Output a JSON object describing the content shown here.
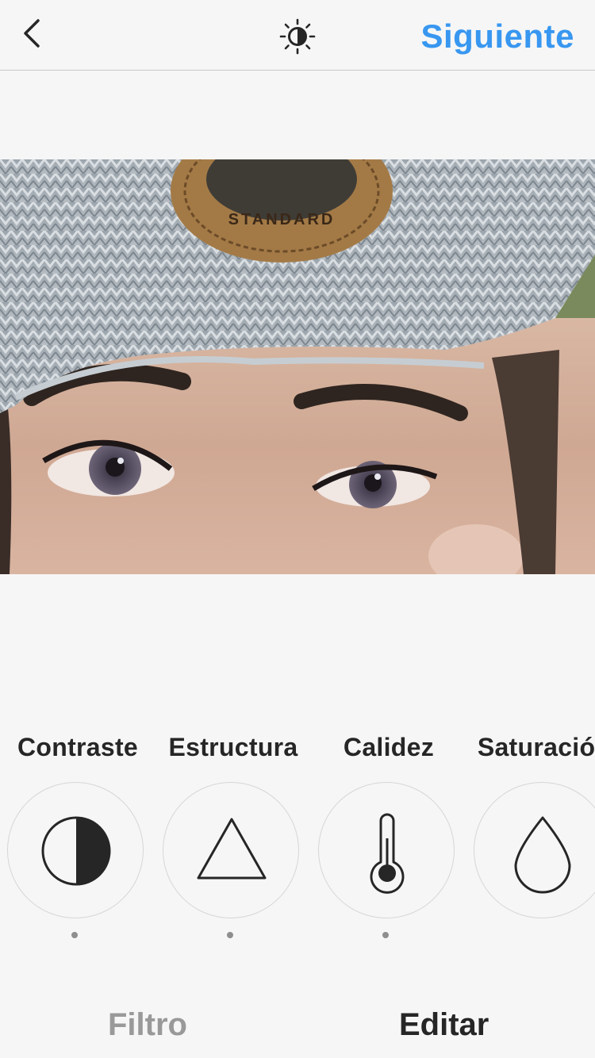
{
  "header": {
    "next_label": "Siguiente",
    "back_icon": "chevron-left-icon",
    "lux_icon": "lux-brightness-icon"
  },
  "photo": {
    "badge_text": "STANDARD"
  },
  "tools": [
    {
      "label": "Contraste",
      "icon": "contrast-icon"
    },
    {
      "label": "Estructura",
      "icon": "triangle-icon"
    },
    {
      "label": "Calidez",
      "icon": "thermometer-icon"
    },
    {
      "label": "Saturación",
      "icon": "droplet-icon"
    }
  ],
  "tabs": {
    "filter_label": "Filtro",
    "edit_label": "Editar",
    "active": "Editar"
  },
  "colors": {
    "accent": "#3897f0",
    "text": "#262626",
    "inactive": "#999999",
    "background": "#f6f6f6"
  }
}
